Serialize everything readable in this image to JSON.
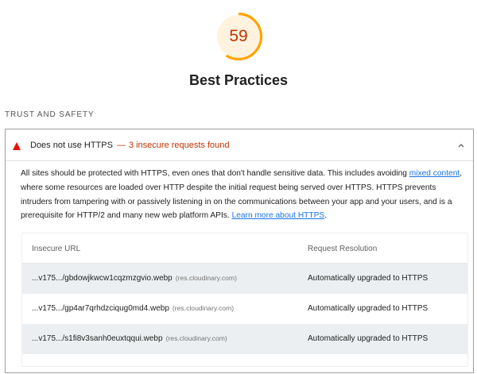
{
  "score": {
    "value": "59",
    "fraction": 0.59,
    "color": "#ffa400",
    "track_color": "#fff3e0",
    "text_color": "#c33300"
  },
  "category_title": "Best Practices",
  "group_title": "TRUST AND SAFETY",
  "audit": {
    "title": "Does not use HTTPS",
    "separator": "—",
    "display_value": "3 insecure requests found",
    "status_icon": "triangle-warning-icon",
    "status_color": "#c33300",
    "expand_icon": "chevron-up-icon",
    "description": {
      "part1": "All sites should be protected with HTTPS, even ones that don't handle sensitive data. This includes avoiding ",
      "link1": "mixed content",
      "part2": ", where some resources are loaded over HTTP despite the initial request being served over HTTPS. HTTPS prevents intruders from tampering with or passively listening in on the communications between your app and your users, and is a prerequisite for HTTP/2 and many new web platform APIs. ",
      "link2": "Learn more about HTTPS",
      "part3": "."
    },
    "table": {
      "headers": [
        "Insecure URL",
        "Request Resolution"
      ],
      "rows": [
        {
          "url": "...v175.../gbdowjkwcw1cqzmzgvio.webp",
          "host": "(res.cloudinary.com)",
          "resolution": "Automatically upgraded to HTTPS"
        },
        {
          "url": "...v175.../gp4ar7qrhdzciqug0md4.webp",
          "host": "(res.cloudinary.com)",
          "resolution": "Automatically upgraded to HTTPS"
        },
        {
          "url": "...v175.../s1fi8v3sanh0euxtqqui.webp",
          "host": "(res.cloudinary.com)",
          "resolution": "Automatically upgraded to HTTPS"
        }
      ]
    }
  },
  "link_color": "#1a73e8"
}
